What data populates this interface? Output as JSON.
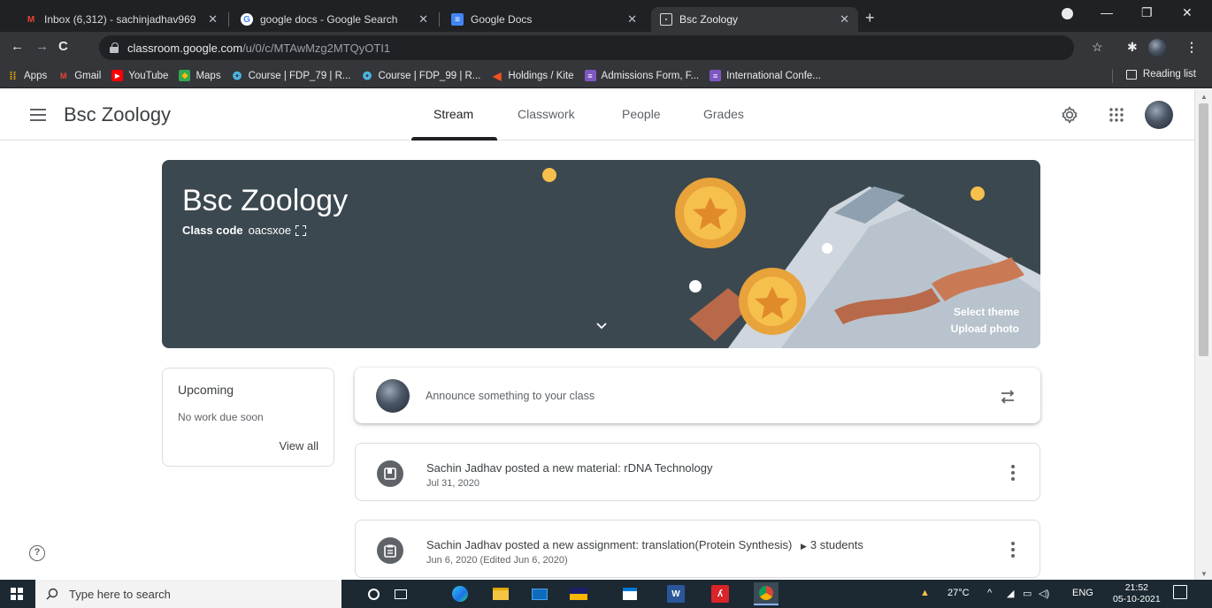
{
  "browser": {
    "tabs": [
      {
        "title": "Inbox (6,312) - sachinjadhav969",
        "icon": "gmail-icon",
        "active": false
      },
      {
        "title": "google docs - Google Search",
        "icon": "google-icon",
        "active": false
      },
      {
        "title": "Google Docs",
        "icon": "docs-icon",
        "active": false
      },
      {
        "title": "Bsc Zoology",
        "icon": "classroom-icon",
        "active": true
      }
    ],
    "url_host": "classroom.google.com",
    "url_path": "/u/0/c/MTAwMzg2MTQyOTI1",
    "bookmarks": [
      {
        "label": "Apps",
        "icon": "apps-grid-icon",
        "color": "#f4b400"
      },
      {
        "label": "Gmail",
        "icon": "gmail-icon",
        "color": "#ea4335"
      },
      {
        "label": "YouTube",
        "icon": "youtube-icon",
        "color": "#ff0000"
      },
      {
        "label": "Maps",
        "icon": "maps-icon",
        "color": "#34a853"
      },
      {
        "label": "Course | FDP_79 | R...",
        "icon": "course-icon",
        "color": "#4fc3f7"
      },
      {
        "label": "Course | FDP_99 | R...",
        "icon": "course-icon",
        "color": "#4fc3f7"
      },
      {
        "label": "Holdings / Kite",
        "icon": "kite-icon",
        "color": "#f4511e"
      },
      {
        "label": "Admissions Form, F...",
        "icon": "forms-icon",
        "color": "#7e57c2"
      },
      {
        "label": "International Confe...",
        "icon": "forms-icon",
        "color": "#7e57c2"
      }
    ],
    "reading_list": "Reading list"
  },
  "app": {
    "title": "Bsc Zoology",
    "tabs": [
      "Stream",
      "Classwork",
      "People",
      "Grades"
    ],
    "active_tab": "Stream"
  },
  "banner": {
    "title": "Bsc Zoology",
    "class_code_label": "Class code",
    "class_code": "oacsxoe",
    "select_theme": "Select theme",
    "upload_photo": "Upload photo",
    "background_color": "#3b484f"
  },
  "upcoming": {
    "heading": "Upcoming",
    "empty_text": "No work due soon",
    "view_all": "View all"
  },
  "announce": {
    "placeholder": "Announce something to your class"
  },
  "posts": [
    {
      "title": "Sachin Jadhav posted a new material: rDNA Technology",
      "date": "Jul 31, 2020",
      "audience": "",
      "icon": "material-icon"
    },
    {
      "title": "Sachin Jadhav posted a new assignment: translation(Protein Synthesis)",
      "date": "Jun 6, 2020 (Edited Jun 6, 2020)",
      "audience": "3 students",
      "icon": "assignment-icon"
    }
  ],
  "taskbar": {
    "search_placeholder": "Type here to search",
    "weather": "27°C",
    "language": "ENG",
    "time": "21:52",
    "date": "05-10-2021"
  }
}
